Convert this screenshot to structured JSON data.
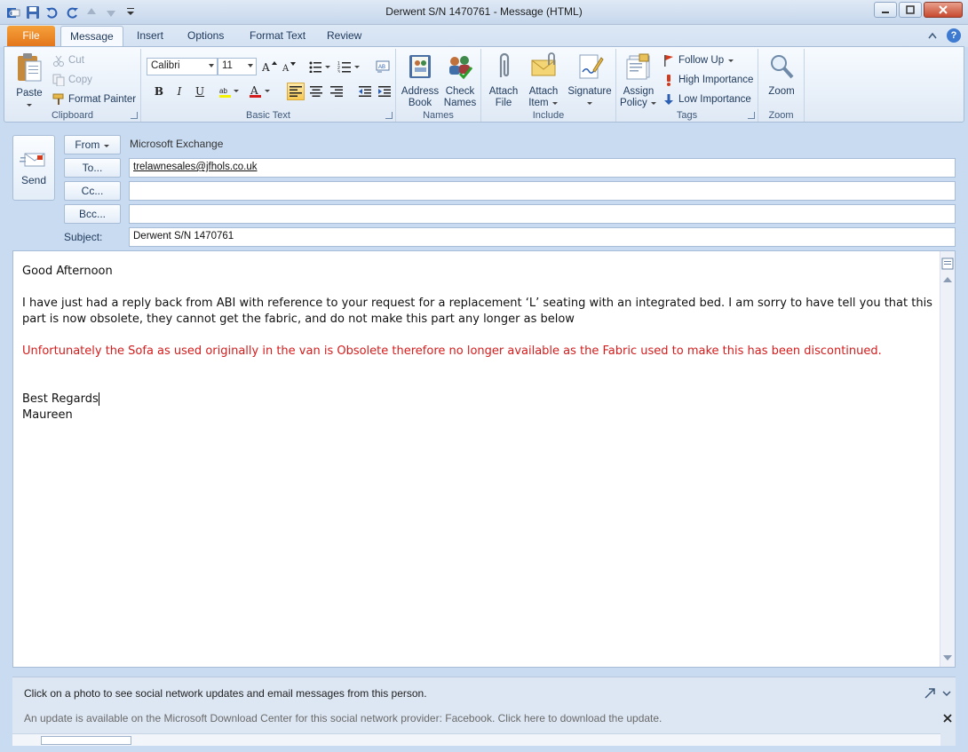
{
  "window": {
    "title": "Derwent S/N 1470761  -  Message (HTML)"
  },
  "tabs": [
    "File",
    "Message",
    "Insert",
    "Options",
    "Format Text",
    "Review"
  ],
  "ribbon": {
    "clipboard": {
      "label": "Clipboard",
      "paste": "Paste",
      "cut": "Cut",
      "copy": "Copy",
      "format_painter": "Format Painter"
    },
    "basic_text": {
      "label": "Basic Text",
      "font": "Calibri",
      "size": "11"
    },
    "names": {
      "label": "Names",
      "address_book_1": "Address",
      "address_book_2": "Book",
      "check_names_1": "Check",
      "check_names_2": "Names"
    },
    "include": {
      "label": "Include",
      "attach_file_1": "Attach",
      "attach_file_2": "File",
      "attach_item_1": "Attach",
      "attach_item_2": "Item",
      "signature": "Signature"
    },
    "tags": {
      "label": "Tags",
      "assign_policy_1": "Assign",
      "assign_policy_2": "Policy",
      "follow_up": "Follow Up",
      "high_importance": "High Importance",
      "low_importance": "Low Importance"
    },
    "zoom": {
      "label": "Zoom",
      "zoom": "Zoom"
    }
  },
  "header": {
    "send": "Send",
    "from_button": "From",
    "from_value": "Microsoft Exchange",
    "to_button": "To...",
    "to_value": "trelawnesales@jfhols.co.uk",
    "cc_button": "Cc...",
    "cc_value": "",
    "bcc_button": "Bcc...",
    "bcc_value": "",
    "subject_label": "Subject:",
    "subject_value": "Derwent S/N 1470761"
  },
  "body": {
    "greeting": "Good Afternoon",
    "paragraph": "I have just had a reply back from ABI with reference to your request for a replacement ‘L’ seating with an integrated bed.  I am sorry to have tell you that this part is now obsolete, they cannot get the fabric, and do not make this part any longer as below",
    "quote": "Unfortunately the Sofa as used originally in the van is Obsolete therefore no longer available as the Fabric used to make this has been discontinued.",
    "signoff": "Best Regards",
    "name": "Maureen"
  },
  "social": {
    "info": "Click on a photo to see social network updates and email messages from this person.",
    "update": "An update is available on the Microsoft Download Center for this social network provider: Facebook. Click here to download the update."
  },
  "colors": {
    "file_tab": "#e3741a",
    "quote_red": "#d41c1c",
    "frame_blue": "#c9dbf0"
  }
}
